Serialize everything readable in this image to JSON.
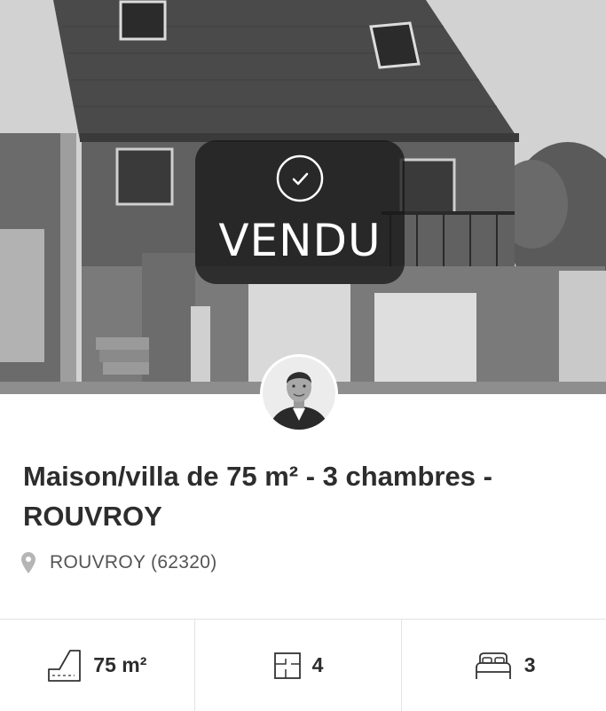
{
  "listing": {
    "status_label": "VENDU",
    "title": "Maison/villa de 75 m² - 3 chambres - ROUVROY",
    "location": "ROUVROY (62320)",
    "features": {
      "area": "75 m²",
      "rooms": "4",
      "bedrooms": "3"
    }
  },
  "icons": {
    "status": "check-circle-icon",
    "location": "map-pin-icon",
    "area": "surface-area-icon",
    "rooms": "floor-plan-icon",
    "bedrooms": "bed-icon"
  },
  "colors": {
    "badge_background": "#181818",
    "badge_text": "#ffffff",
    "title_text": "#2d2d2d",
    "location_text": "#555555",
    "pin_icon": "#b5b5b5",
    "divider": "#e3e3e3"
  }
}
